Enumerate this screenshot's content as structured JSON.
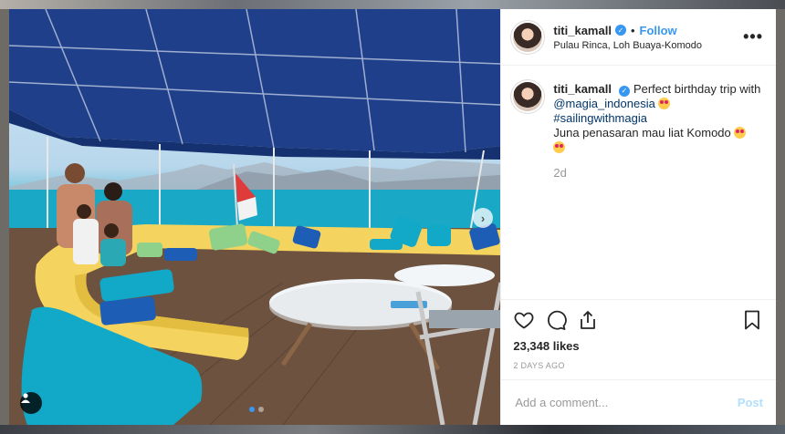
{
  "post": {
    "username": "titi_kamall",
    "follow_label": "Follow",
    "separator": "•",
    "location": "Pulau Rinca, Loh Buaya-Komodo",
    "more_icon": "more-options-icon"
  },
  "caption": {
    "username": "titi_kamall",
    "line1": "Perfect birthday trip with",
    "mention": "@magia_indonesia",
    "hashtag": "#sailingwithmagia",
    "line3": "Juna penasaran mau liat Komodo",
    "time": "2d"
  },
  "actions": {
    "like_icon": "heart-icon",
    "comment_icon": "comment-icon",
    "share_icon": "share-icon",
    "save_icon": "bookmark-icon",
    "likes": "23,348 likes",
    "posted": "2 DAYS AGO"
  },
  "comment": {
    "placeholder": "Add a comment...",
    "post_label": "Post"
  },
  "carousel": {
    "slides": 2,
    "active": 1
  },
  "colors": {
    "accent": "#3897f0",
    "text": "#262626",
    "muted": "#999999"
  }
}
